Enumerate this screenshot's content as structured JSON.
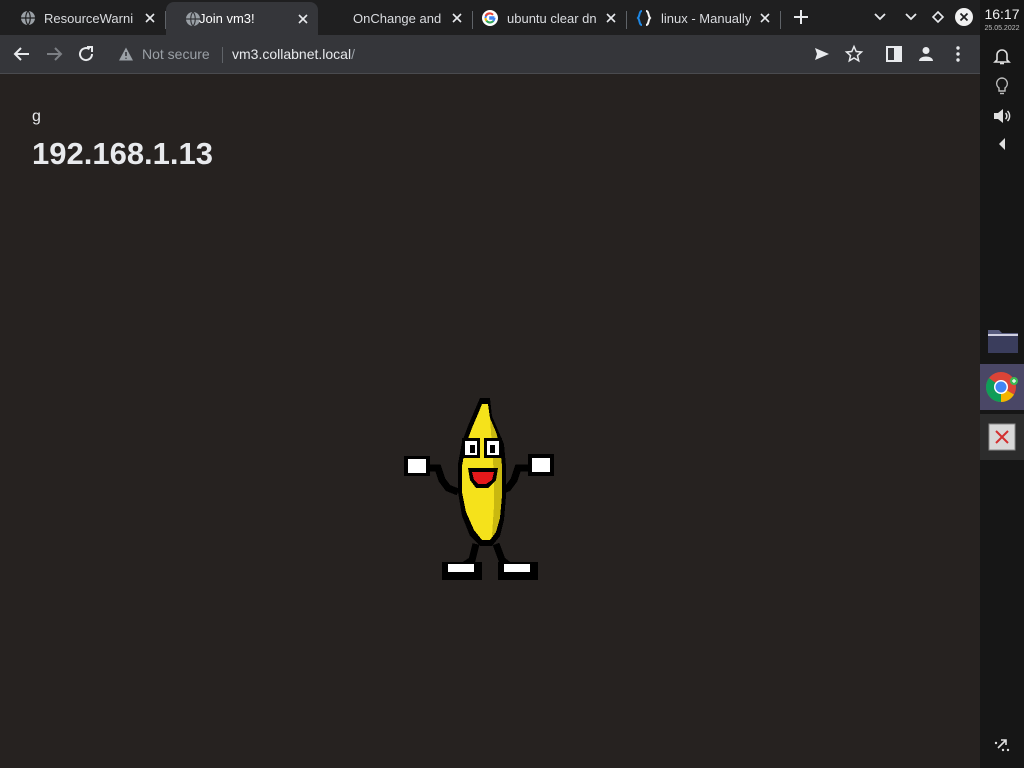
{
  "tabs": [
    {
      "label": "ResourceWarning",
      "icon": "globe-icon"
    },
    {
      "label": "Join vm3!",
      "icon": "globe-icon",
      "active": true
    },
    {
      "label": "OnChange and",
      "icon": "blank"
    },
    {
      "label": "ubuntu clear dns",
      "icon": "google-icon"
    },
    {
      "label": "linux - Manually",
      "icon": "braces-icon"
    }
  ],
  "omnibox": {
    "security": "Not secure",
    "url_host": "vm3.collabnet.local",
    "url_path": "/"
  },
  "page": {
    "subtitle": "g",
    "title": "192.168.1.13",
    "image": "dancing-banana"
  },
  "system": {
    "time": "16:17",
    "date": "25.05.2022"
  },
  "colors": {
    "page_bg": "#262220",
    "tabstrip_bg": "#1f1f20",
    "toolbar_bg": "#35363a",
    "panel_bg": "#161616",
    "dock_active": "#4a4766"
  }
}
